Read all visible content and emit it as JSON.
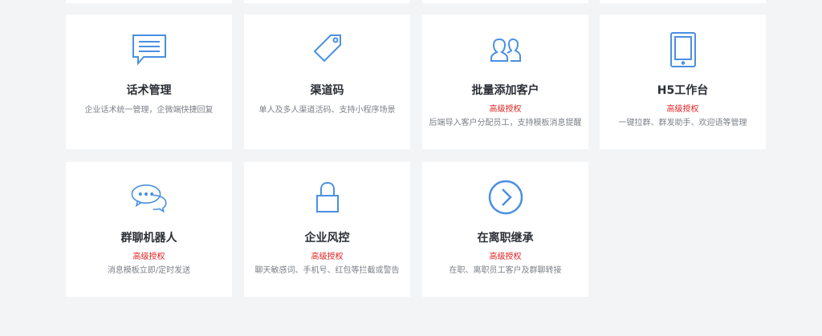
{
  "cards": [
    {
      "title": "话术管理",
      "badge": "",
      "desc": "企业话术统一管理，企微端快捷回复",
      "icon": "message-icon"
    },
    {
      "title": "渠道码",
      "badge": "",
      "desc": "单人及多人渠道活码、支持小程序场景",
      "icon": "tag-icon"
    },
    {
      "title": "批量添加客户",
      "badge": "高级授权",
      "desc": "后端导入客户分配员工，支持模板消息提醒",
      "icon": "users-icon"
    },
    {
      "title": "H5工作台",
      "badge": "高级授权",
      "desc": "一键拉群、群发助手、欢迎语等管理",
      "icon": "tablet-icon"
    },
    {
      "title": "群聊机器人",
      "badge": "高级授权",
      "desc": "消息模板立即/定时发送",
      "icon": "chat-bubbles-icon"
    },
    {
      "title": "企业风控",
      "badge": "高级授权",
      "desc": "聊天敏感词、手机号、红包等拦截或警告",
      "icon": "lock-icon"
    },
    {
      "title": "在离职继承",
      "badge": "高级授权",
      "desc": "在职、离职员工客户及群聊转接",
      "icon": "arrow-right-circle-icon"
    }
  ],
  "colors": {
    "icon": "#4a90e2",
    "badge": "#e02020",
    "card": "#ffffff",
    "background": "#f3f4f6"
  }
}
